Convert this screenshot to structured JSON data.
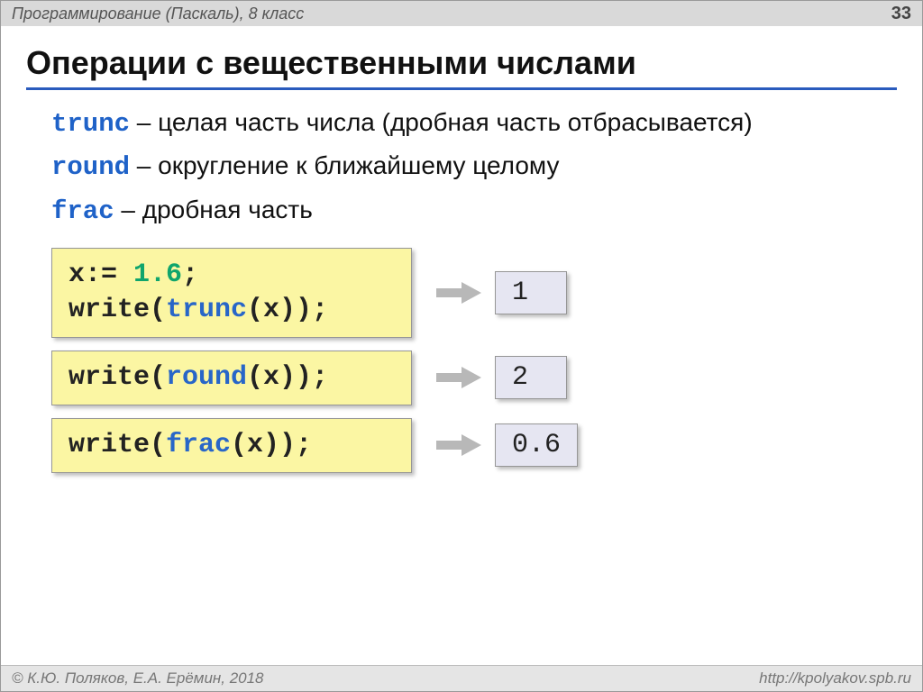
{
  "header": {
    "left": "Программирование (Паскаль), 8 класс",
    "page": "33"
  },
  "title": "Операции с вещественными числами",
  "definitions": [
    {
      "kw": "trunc",
      "text": " – целая часть числа (дробная часть отбрасывается)"
    },
    {
      "kw": "round",
      "text": " – округление к ближайшему целому"
    },
    {
      "kw": "frac",
      "text": " – дробная часть"
    }
  ],
  "examples": [
    {
      "code_lines": [
        [
          {
            "t": "x:= ",
            "c": ""
          },
          {
            "t": "1.6",
            "c": "num"
          },
          {
            "t": ";",
            "c": ""
          }
        ],
        [
          {
            "t": "write(",
            "c": ""
          },
          {
            "t": "trunc",
            "c": "fn"
          },
          {
            "t": "(x));",
            "c": ""
          }
        ]
      ],
      "out": "1"
    },
    {
      "code_lines": [
        [
          {
            "t": "write(",
            "c": ""
          },
          {
            "t": "round",
            "c": "fn"
          },
          {
            "t": "(x));",
            "c": ""
          }
        ]
      ],
      "out": "2"
    },
    {
      "code_lines": [
        [
          {
            "t": "write(",
            "c": ""
          },
          {
            "t": "frac",
            "c": "fn"
          },
          {
            "t": "(x));",
            "c": ""
          }
        ]
      ],
      "out": "0.6"
    }
  ],
  "footer": {
    "left": "© К.Ю. Поляков, Е.А. Ерёмин, 2018",
    "right": "http://kpolyakov.spb.ru"
  }
}
